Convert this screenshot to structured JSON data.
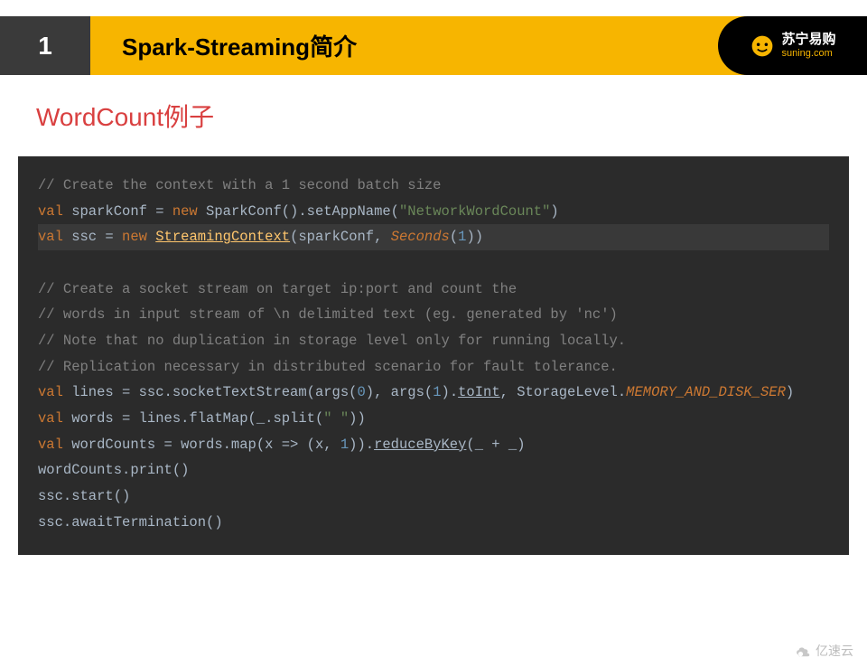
{
  "header": {
    "number": "1",
    "title": "Spark-Streaming简介",
    "logo_cn": "苏宁易购",
    "logo_en": "suning.com"
  },
  "subtitle": {
    "en": "WordCount",
    "cn": "例子"
  },
  "code": {
    "l1": "// Create the context with a 1 second batch size",
    "l2_val": "val",
    "l2_a": " sparkConf = ",
    "l2_new": "new",
    "l2_b": " SparkConf().setAppName(",
    "l2_str": "\"NetworkWordCount\"",
    "l2_c": ")",
    "l3_val": "val",
    "l3_a": " ssc = ",
    "l3_new": "new",
    "l3_b": " ",
    "l3_sc": "StreamingContext",
    "l3_c": "(sparkConf, ",
    "l3_sec": "Seconds",
    "l3_d": "(",
    "l3_n": "1",
    "l3_e": "))",
    "l5": "// Create a socket stream on target ip:port and count the",
    "l6": "// words in input stream of \\n delimited text (eg. generated by 'nc')",
    "l7": "// Note that no duplication in storage level only for running locally.",
    "l8": "// Replication necessary in distributed scenario for fault tolerance.",
    "l9_val": "val",
    "l9_a": " lines = ssc.socketTextStream(args(",
    "l9_n0": "0",
    "l9_b": "), args(",
    "l9_n1": "1",
    "l9_c": ").",
    "l9_toint": "toInt",
    "l9_d": ", StorageLevel.",
    "l9_mem": "MEMORY_AND_DISK_SER",
    "l9_e": ")",
    "l10_val": "val",
    "l10_a": " words = lines.flatMap(_.split(",
    "l10_str": "\" \"",
    "l10_b": "))",
    "l11_val": "val",
    "l11_a": " wordCounts = words.map(x => (x, ",
    "l11_n": "1",
    "l11_b": ")).",
    "l11_rbk": "reduceByKey",
    "l11_c": "(_ + _)",
    "l12": "wordCounts.print()",
    "l13": "ssc.start()",
    "l14": "ssc.awaitTermination()"
  },
  "watermark": "亿速云"
}
